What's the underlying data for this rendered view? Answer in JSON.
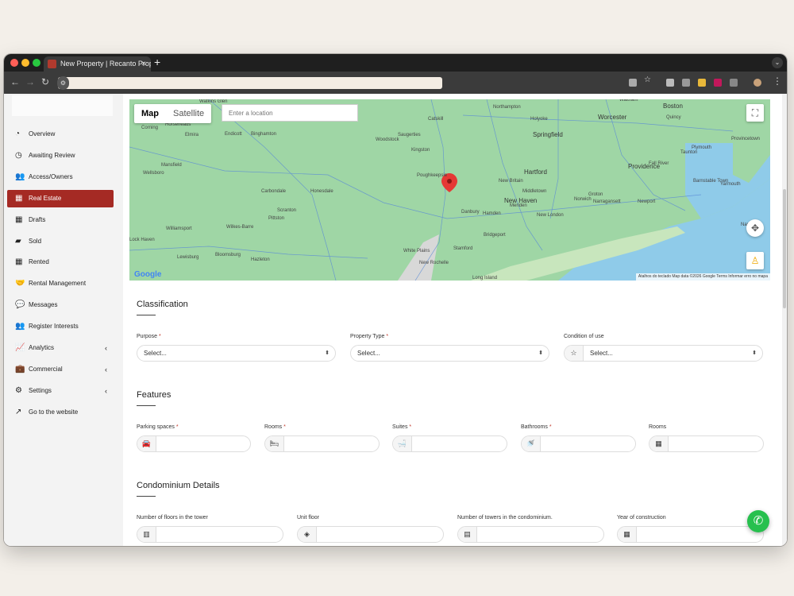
{
  "browser": {
    "tab_title": "New Property | Recanto Prope",
    "tab_close": "×",
    "new_tab": "+"
  },
  "sidebar": {
    "items": [
      {
        "label": "Overview",
        "icon": "gauge-icon",
        "active": false
      },
      {
        "label": "Awaiting Review",
        "icon": "clock-icon",
        "active": false
      },
      {
        "label": "Access/Owners",
        "icon": "users-icon",
        "active": false
      },
      {
        "label": "Real Estate",
        "icon": "building-icon",
        "active": true
      },
      {
        "label": "Drafts",
        "icon": "building-icon",
        "active": false
      },
      {
        "label": "Sold",
        "icon": "bag-icon",
        "active": false
      },
      {
        "label": "Rented",
        "icon": "building-icon",
        "active": false
      },
      {
        "label": "Rental Management",
        "icon": "handshake-icon",
        "active": false
      },
      {
        "label": "Messages",
        "icon": "comments-icon",
        "active": false
      },
      {
        "label": "Register Interests",
        "icon": "users-icon",
        "active": false
      },
      {
        "label": "Analytics",
        "icon": "chart-icon",
        "active": false,
        "arrow": "‹"
      },
      {
        "label": "Commercial",
        "icon": "briefcase-icon",
        "active": false,
        "arrow": "‹"
      },
      {
        "label": "Settings",
        "icon": "gear-icon",
        "active": false,
        "arrow": "‹"
      },
      {
        "label": "Go to the website",
        "icon": "external-link-icon",
        "active": false
      }
    ]
  },
  "map": {
    "tab_map": "Map",
    "tab_satellite": "Satellite",
    "search_placeholder": "Enter a location",
    "google": "Google",
    "attribution": "Atalhos do teclado   Map data ©2026 Google   Terms   Informar erro no mapa",
    "cities": [
      {
        "name": "Boston",
        "big": true
      },
      {
        "name": "Worcester",
        "big": true
      },
      {
        "name": "Springfield",
        "big": true
      },
      {
        "name": "Hartford",
        "big": true
      },
      {
        "name": "Providence",
        "big": true
      },
      {
        "name": "New Haven",
        "big": true
      },
      {
        "name": "Northampton",
        "big": false
      },
      {
        "name": "Waltham",
        "big": false
      },
      {
        "name": "Quincy",
        "big": false
      },
      {
        "name": "Holyoke",
        "big": false
      },
      {
        "name": "Taunton",
        "big": false
      },
      {
        "name": "Plymouth",
        "big": false
      },
      {
        "name": "Provincetown",
        "big": false
      },
      {
        "name": "Fall River",
        "big": false
      },
      {
        "name": "Barnstable Town",
        "big": false
      },
      {
        "name": "Yarmouth",
        "big": false
      },
      {
        "name": "New Britain",
        "big": false
      },
      {
        "name": "Middletown",
        "big": false
      },
      {
        "name": "Norwich",
        "big": false
      },
      {
        "name": "Groton",
        "big": false
      },
      {
        "name": "Narragansett",
        "big": false
      },
      {
        "name": "Newport",
        "big": false
      },
      {
        "name": "New London",
        "big": false
      },
      {
        "name": "Hamden",
        "big": false
      },
      {
        "name": "Meriden",
        "big": false
      },
      {
        "name": "Danbury",
        "big": false
      },
      {
        "name": "Bridgeport",
        "big": false
      },
      {
        "name": "Stamford",
        "big": false
      },
      {
        "name": "White Plains",
        "big": false
      },
      {
        "name": "New Rochelle",
        "big": false
      },
      {
        "name": "Long Island",
        "big": false
      },
      {
        "name": "Catskill",
        "big": false
      },
      {
        "name": "Saugerties",
        "big": false
      },
      {
        "name": "Kingston",
        "big": false
      },
      {
        "name": "Poughkeepsie",
        "big": false
      },
      {
        "name": "Woodstock",
        "big": false
      },
      {
        "name": "Binghamton",
        "big": false
      },
      {
        "name": "Endicott",
        "big": false
      },
      {
        "name": "Corning",
        "big": false
      },
      {
        "name": "Horseheads",
        "big": false
      },
      {
        "name": "Elmira",
        "big": false
      },
      {
        "name": "Watkins Glen",
        "big": false
      },
      {
        "name": "Mansfield",
        "big": false
      },
      {
        "name": "Wellsboro",
        "big": false
      },
      {
        "name": "Carbondale",
        "big": false
      },
      {
        "name": "Honesdale",
        "big": false
      },
      {
        "name": "Scranton",
        "big": false
      },
      {
        "name": "Pittston",
        "big": false
      },
      {
        "name": "Wilkes-Barre",
        "big": false
      },
      {
        "name": "Williamsport",
        "big": false
      },
      {
        "name": "Lock Haven",
        "big": false
      },
      {
        "name": "Lewisburg",
        "big": false
      },
      {
        "name": "Bloomsburg",
        "big": false
      },
      {
        "name": "Hazleton",
        "big": false
      },
      {
        "name": "Nantucket",
        "big": false
      }
    ]
  },
  "classification": {
    "title": "Classification",
    "purpose_label": "Purpose",
    "purpose_value": "Select...",
    "type_label": "Property Type",
    "type_value": "Select...",
    "condition_label": "Condition of use",
    "condition_value": "Select...",
    "required_mark": "*"
  },
  "features": {
    "title": "Features",
    "parking_label": "Parking spaces",
    "rooms_label": "Rooms",
    "suites_label": "Suites",
    "bathrooms_label": "Bathrooms",
    "rooms2_label": "Rooms"
  },
  "condominium": {
    "title": "Condominium Details",
    "floors_label": "Number of floors in the tower",
    "unit_floor_label": "Unit floor",
    "towers_label": "Number of towers in the condominium.",
    "year_label": "Year of construction"
  },
  "colors": {
    "accent": "#a52a24",
    "whatsapp": "#27c04e",
    "map_land": "#9fd6a5",
    "map_water": "#8fcbe9"
  }
}
